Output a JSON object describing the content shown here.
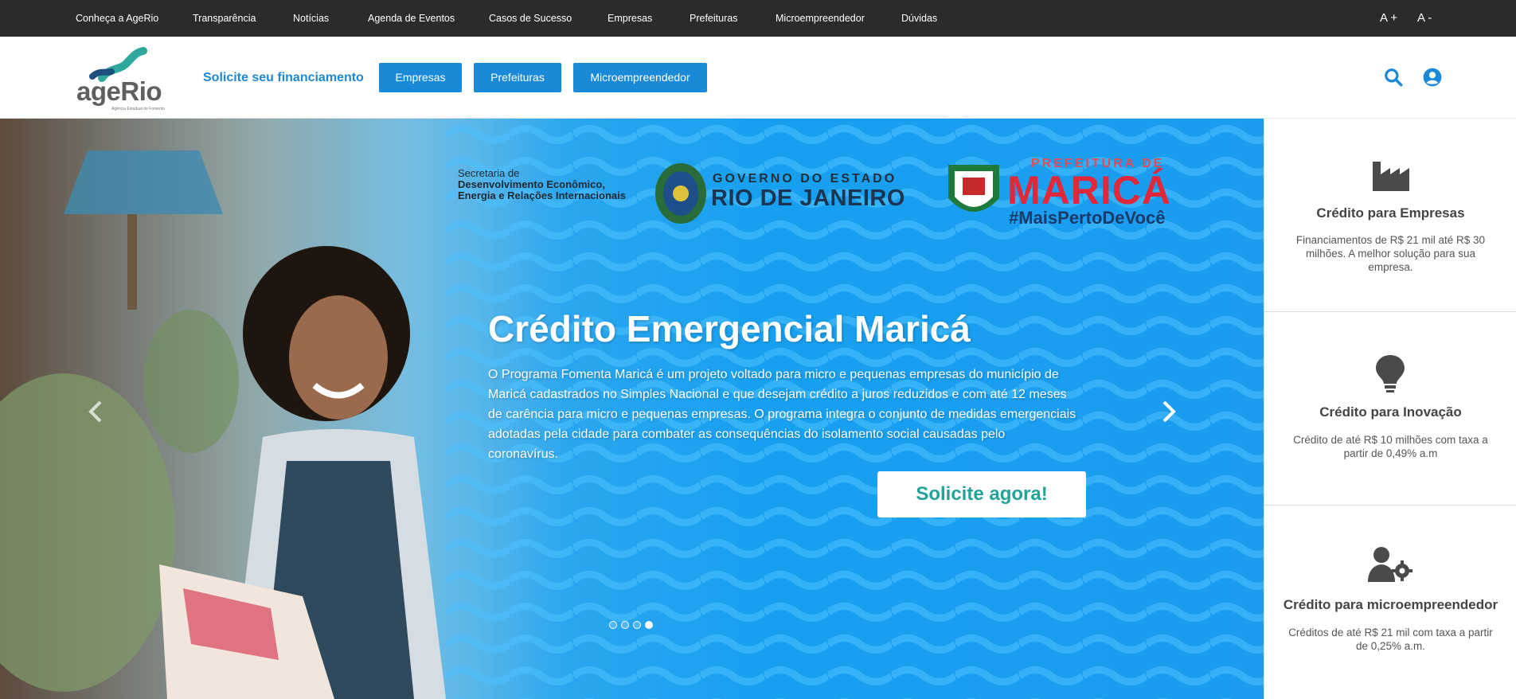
{
  "topnav": {
    "items": [
      "Conheça a AgeRio",
      "Transparência",
      "Notícias",
      "Agenda de Eventos",
      "Casos de Sucesso",
      "Empresas",
      "Prefeituras",
      "Microempreendedor",
      "Dúvidas"
    ],
    "font_increase": "A +",
    "font_decrease": "A -"
  },
  "header": {
    "logo_text": "ageRio",
    "logo_subtitle": "Agência Estadual de Fomento",
    "solicite_label": "Solicite seu financiamento",
    "buttons": [
      "Empresas",
      "Prefeituras",
      "Microempreendedor"
    ],
    "icons": [
      "search-icon",
      "user-account-icon"
    ],
    "accent_color": "#1a8ad8"
  },
  "hero": {
    "partners": {
      "secretaria_line1": "Secretaria de",
      "secretaria_line2": "Desenvolvimento Econômico,",
      "secretaria_line3": "Energia e Relações Internacionais",
      "gov_small": "GOVERNO DO ESTADO",
      "gov_big": "RIO DE JANEIRO",
      "marica_small": "PREFEITURA DE",
      "marica_big": "MARICÁ",
      "marica_tag": "#MaisPertoDeVocê"
    },
    "title": "Crédito Emergencial Maricá",
    "description": "O Programa Fomenta Maricá é um projeto voltado para micro e pequenas empresas do município de Maricá cadastrados no Simples Nacional e que desejam crédito a juros reduzidos e com até 12 meses de carência para micro e pequenas empresas. O programa integra o conjunto de medidas emergenciais adotadas pela cidade para combater as consequências do isolamento social causadas pelo coronavírus.",
    "cta_label": "Solicite agora!",
    "slides_total": 4,
    "active_slide": 4
  },
  "cards": [
    {
      "icon": "factory-icon",
      "title": "Crédito para Empresas",
      "description": "Financiamentos de R$ 21 mil até R$ 30 milhões. A melhor solução para sua empresa."
    },
    {
      "icon": "lightbulb-icon",
      "title": "Crédito para Inovação",
      "description": "Crédito de até R$ 10 milhões com taxa a partir de 0,49% a.m"
    },
    {
      "icon": "user-gear-icon",
      "title": "Crédito para microempreendedor",
      "description": "Créditos de até R$ 21 mil com taxa a partir de 0,25% a.m."
    }
  ]
}
